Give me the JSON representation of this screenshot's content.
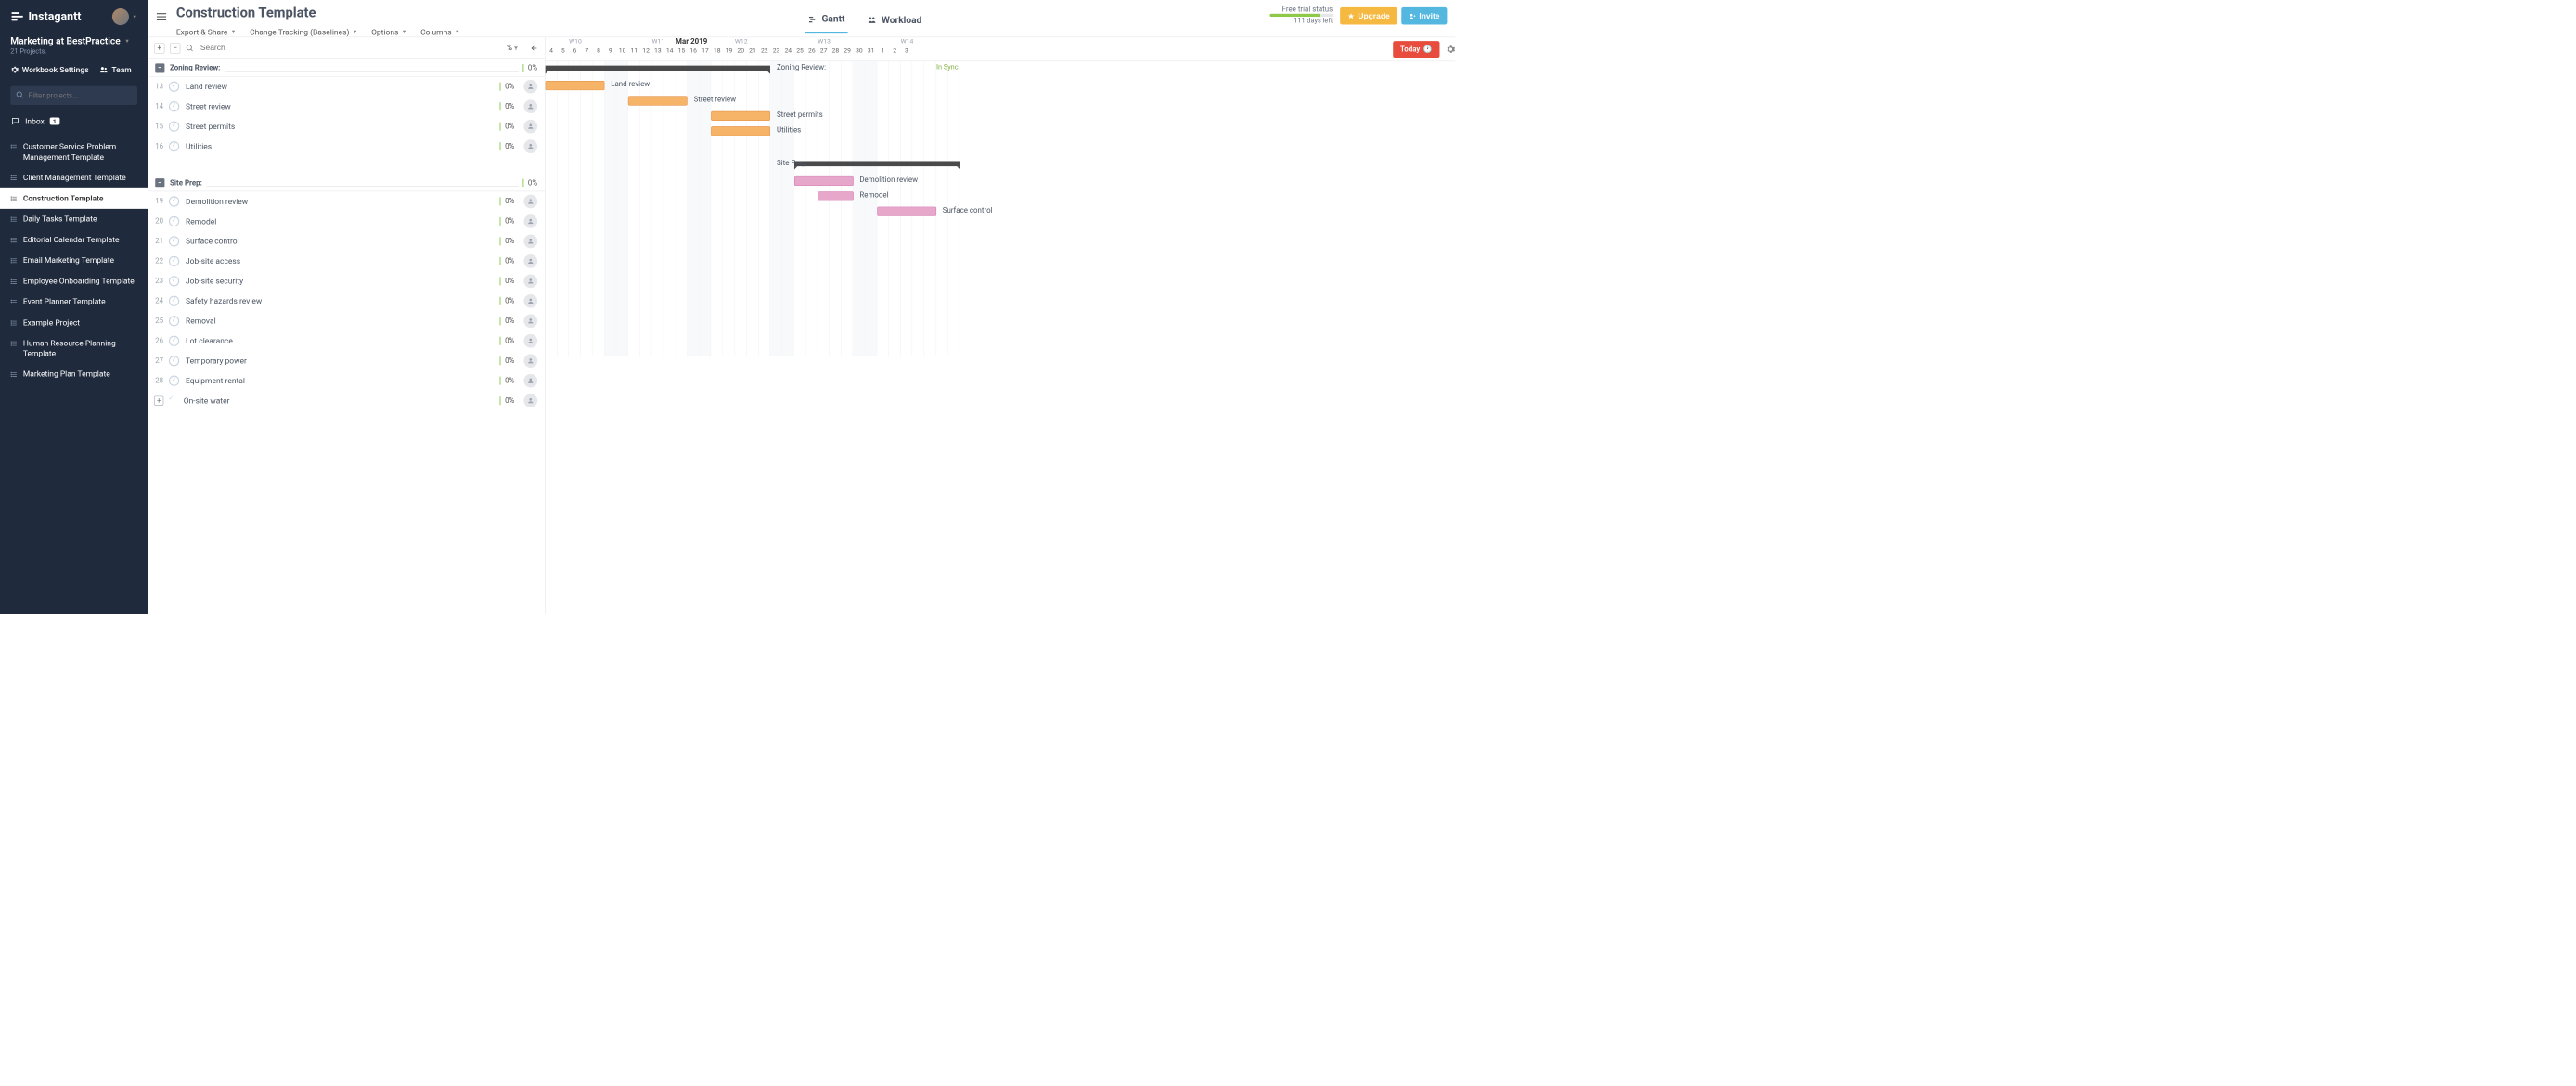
{
  "brand": "Instagantt",
  "workspace": {
    "name": "Marketing at BestPractice",
    "projectsCount": "21 Projects."
  },
  "sidebarTools": {
    "settings": "Workbook Settings",
    "team": "Team"
  },
  "filterPlaceholder": "Filter projects...",
  "inbox": {
    "label": "Inbox",
    "count": "1"
  },
  "projects": [
    {
      "name": "Customer Service Problem Management Template",
      "active": false
    },
    {
      "name": "Client Management Template",
      "active": false
    },
    {
      "name": "Construction Template",
      "active": true
    },
    {
      "name": "Daily Tasks Template",
      "active": false
    },
    {
      "name": "Editorial Calendar Template",
      "active": false
    },
    {
      "name": "Email Marketing Template",
      "active": false
    },
    {
      "name": "Employee Onboarding Template",
      "active": false
    },
    {
      "name": "Event Planner Template",
      "active": false
    },
    {
      "name": "Example Project",
      "active": false
    },
    {
      "name": "Human Resource Planning Template",
      "active": false
    },
    {
      "name": "Marketing Plan Template",
      "active": false
    }
  ],
  "pageTitle": "Construction Template",
  "menu": {
    "export": "Export & Share",
    "tracking": "Change Tracking (Baselines)",
    "options": "Options",
    "columns": "Columns"
  },
  "viewTabs": {
    "gantt": "Gantt",
    "workload": "Workload"
  },
  "trial": {
    "label": "Free trial status",
    "daysLeft": "111 days left",
    "pct": 80
  },
  "buttons": {
    "upgrade": "Upgrade",
    "invite": "Invite",
    "today": "Today"
  },
  "searchPlaceholder": "Search",
  "pctSymbol": "%",
  "timeline": {
    "monthLabel": "Mar 2019",
    "weeks": [
      "W10",
      "W11",
      "W12",
      "W13",
      "W14"
    ],
    "days": [
      "4",
      "5",
      "6",
      "7",
      "8",
      "9",
      "10",
      "11",
      "12",
      "13",
      "14",
      "15",
      "16",
      "17",
      "18",
      "19",
      "20",
      "21",
      "22",
      "23",
      "24",
      "25",
      "26",
      "27",
      "28",
      "29",
      "30",
      "31",
      "1",
      "2",
      "3"
    ],
    "weekendIdx": [
      5,
      6,
      12,
      13,
      19,
      20,
      26,
      27
    ],
    "syncLabel": "In Sync"
  },
  "chart_data": {
    "type": "gantt",
    "xlabel": "Date",
    "title": "Construction Template",
    "x_range": [
      "2019-03-04",
      "2019-04-03"
    ],
    "groups": [
      {
        "name": "Zoning Review:",
        "pct": "0%",
        "barStartDay": 0,
        "barEndDay": 19,
        "tasks": [
          {
            "num": 13,
            "name": "Land review",
            "pct": "0%",
            "startDay": 0,
            "endDay": 5,
            "color": "orange"
          },
          {
            "num": 14,
            "name": "Street review",
            "pct": "0%",
            "startDay": 7,
            "endDay": 12,
            "color": "orange"
          },
          {
            "num": 15,
            "name": "Street permits",
            "pct": "0%",
            "startDay": 14,
            "endDay": 19,
            "color": "orange"
          },
          {
            "num": 16,
            "name": "Utilities",
            "pct": "0%",
            "startDay": 14,
            "endDay": 19,
            "color": "orange"
          }
        ]
      },
      {
        "name": "Site Prep:",
        "pct": "0%",
        "barStartDay": 21,
        "barEndDay": 60,
        "tasks": [
          {
            "num": 19,
            "name": "Demolition review",
            "pct": "0%",
            "startDay": 21,
            "endDay": 26,
            "color": "pink"
          },
          {
            "num": 20,
            "name": "Remodel",
            "pct": "0%",
            "startDay": 23,
            "endDay": 26,
            "color": "pink"
          },
          {
            "num": 21,
            "name": "Surface control",
            "pct": "0%",
            "startDay": 28,
            "endDay": 33,
            "color": "pink"
          },
          {
            "num": 22,
            "name": "Job-site access",
            "pct": "0%"
          },
          {
            "num": 23,
            "name": "Job-site security",
            "pct": "0%"
          },
          {
            "num": 24,
            "name": "Safety hazards review",
            "pct": "0%"
          },
          {
            "num": 25,
            "name": "Removal",
            "pct": "0%"
          },
          {
            "num": 26,
            "name": "Lot clearance",
            "pct": "0%"
          },
          {
            "num": 27,
            "name": "Temporary power",
            "pct": "0%"
          },
          {
            "num": 28,
            "name": "Equipment rental",
            "pct": "0%"
          },
          {
            "num": "",
            "name": "On-site water",
            "pct": "0%",
            "add": true
          }
        ]
      }
    ]
  }
}
